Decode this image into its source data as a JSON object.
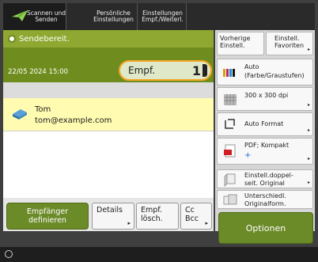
{
  "topbar": {
    "send_tab": {
      "line1": "Scannen und",
      "line2": "Senden"
    },
    "personal_tab": {
      "line1": "Persönliche",
      "line2": "Einstellungen"
    },
    "recipient_settings_tab": {
      "line1": "Einstellungen",
      "line2": "Empf./Weiterl."
    }
  },
  "status": {
    "text": "Sendebereit."
  },
  "datetime": "22/05 2024 15:00",
  "recipient_counter": {
    "label": "Empf.",
    "count": "1"
  },
  "recipients": [
    {
      "name": "Tom",
      "email": "tom@example.com"
    }
  ],
  "bottom_buttons": {
    "define_recipient": {
      "line1": "Empfänger",
      "line2": "definieren"
    },
    "details": {
      "label": "Details"
    },
    "delete_recipient": {
      "line1": "Empf.",
      "line2": "lösch."
    },
    "cc_bcc": {
      "line1": "Cc",
      "line2": "Bcc"
    }
  },
  "right_panel": {
    "previous_settings": {
      "line1": "Vorherige",
      "line2": "Einstell."
    },
    "favorites": {
      "line1": "Einstell.",
      "line2": "Favoriten"
    },
    "color": {
      "line1": "Auto",
      "line2": "(Farbe/Graustufen)"
    },
    "resolution": {
      "label": "300 x 300 dpi"
    },
    "format": {
      "label": "Auto Format"
    },
    "file_format": {
      "label": "PDF; Kompakt"
    },
    "duplex": {
      "line1": "Einstell.doppel-",
      "line2": "seit. Original"
    },
    "mixed": {
      "line1": "Unterschiedl.",
      "line2": "Originalform."
    },
    "options": {
      "label": "Optionen"
    }
  },
  "colors": {
    "accent_green": "#6b8a28",
    "status_green": "#8ea832",
    "highlight_row": "#fffbb0",
    "counter_border": "#f5a623"
  }
}
